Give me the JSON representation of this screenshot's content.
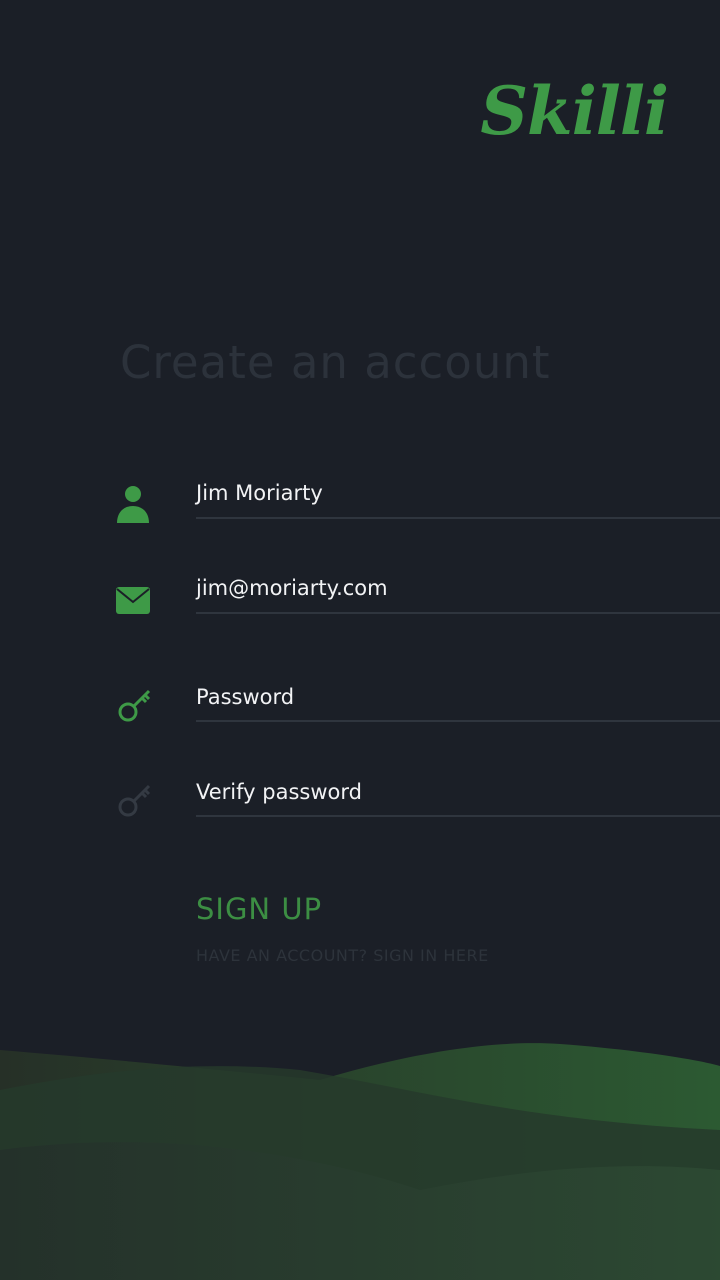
{
  "brand": {
    "logo_text": "Skilli",
    "accent_color": "#3e9a47"
  },
  "form": {
    "title": "Create an account",
    "fields": [
      {
        "icon": "user-icon",
        "value": "Jim Moriarty"
      },
      {
        "icon": "envelope-icon",
        "value": "jim@moriarty.com"
      },
      {
        "icon": "key-icon",
        "value": "Password"
      },
      {
        "icon": "key-icon",
        "value": "Verify password"
      }
    ],
    "signup_label": "SIGN UP",
    "signin_link": "HAVE AN ACCOUNT? SIGN IN HERE"
  }
}
